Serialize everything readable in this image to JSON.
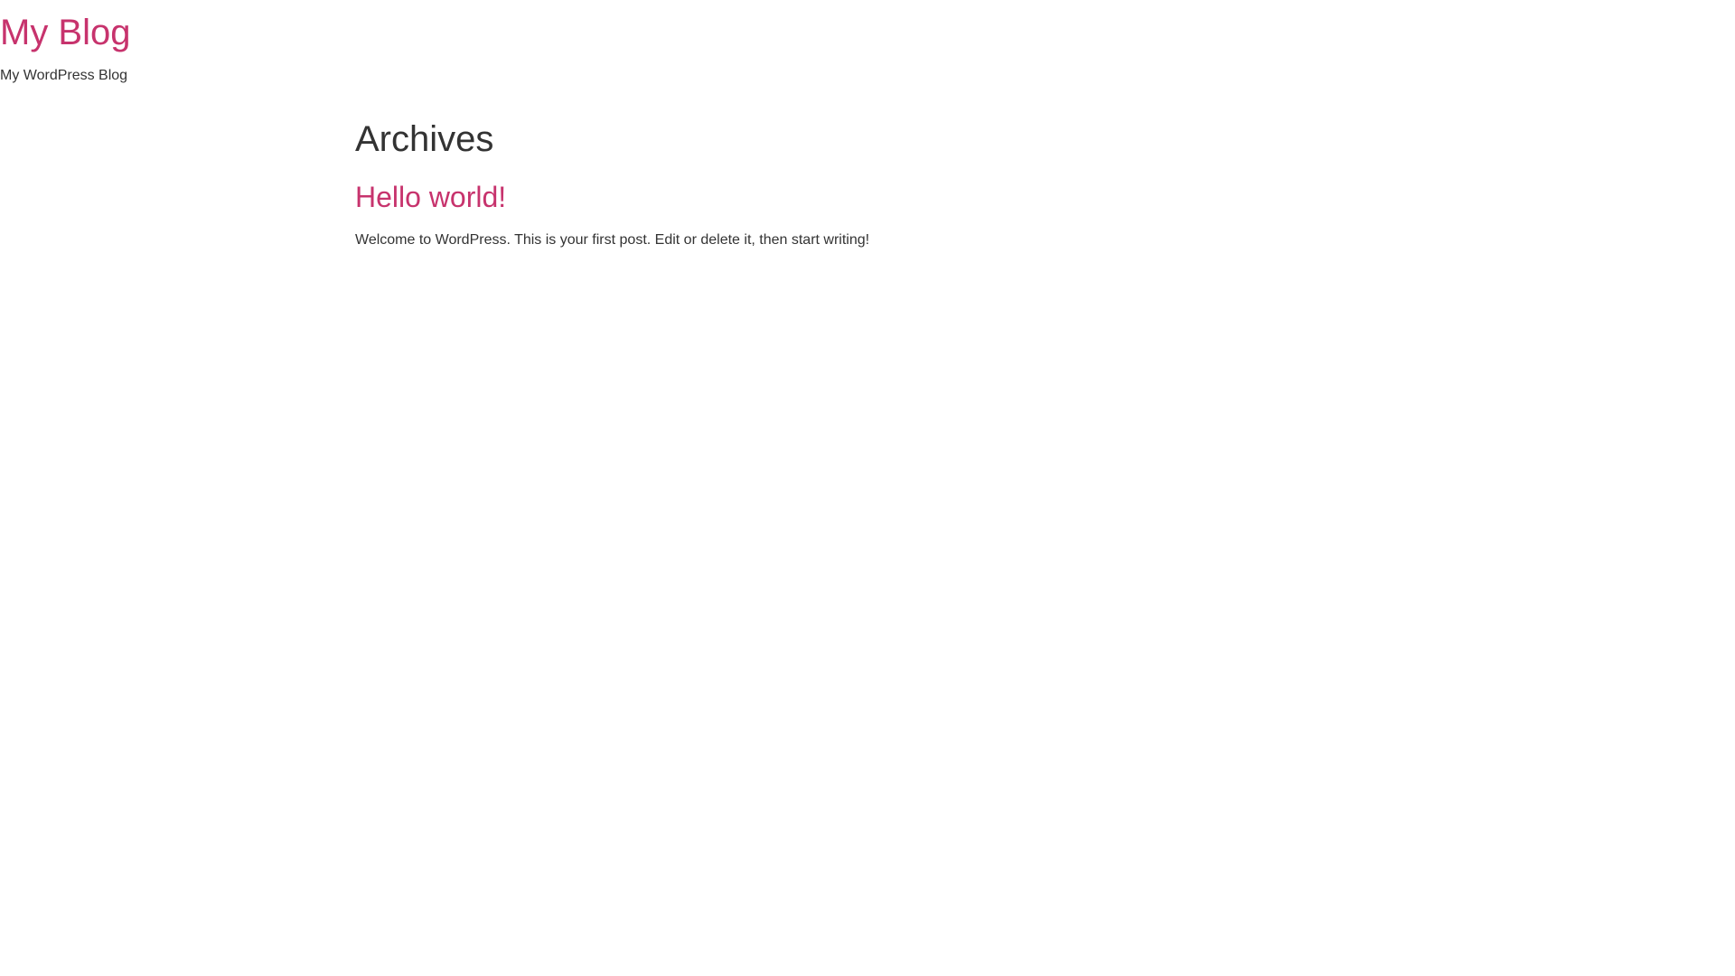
{
  "site": {
    "title": "My Blog",
    "tagline": "My WordPress Blog"
  },
  "archive": {
    "heading": "Archives",
    "posts": [
      {
        "title": "Hello world!",
        "excerpt": "Welcome to WordPress. This is your first post. Edit or delete it, then start writing!"
      }
    ]
  },
  "colors": {
    "link": "#c7336d",
    "text": "#333333",
    "background": "#ffffff"
  }
}
